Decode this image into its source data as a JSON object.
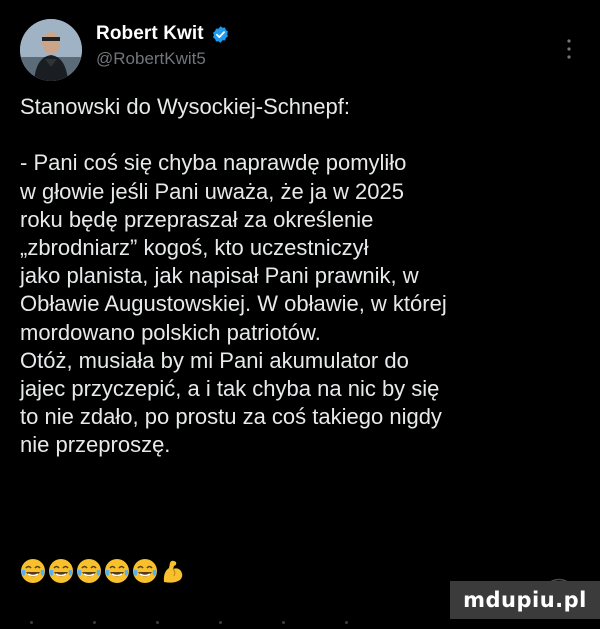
{
  "author": {
    "display_name": "Robert Kwit",
    "handle": "@RobertKwit5",
    "verified": true,
    "verified_color": "#1d9bf0"
  },
  "tweet": {
    "lines": [
      "Stanowski do Wysockiej-Schnepf:",
      "",
      "- Pani coś się chyba naprawdę pomyliło",
      "w głowie jeśli Pani uważa, że ja w 2025",
      "roku będę przepraszał za określenie",
      "„zbrodniarz” kogoś, kto uczestniczył",
      "jako planista, jak napisał Pani prawnik, w",
      "Obławie Augustowskiej. W obławie, w której",
      "mordowano polskich patriotów.",
      "Otóż, musiała by mi Pani akumulator do",
      "jajec przyczepić, a i tak chyba na nic by się",
      "to nie zdało, po prostu za coś takiego nigdy",
      "nie przeproszę."
    ],
    "emojis": [
      "tears-of-joy-icon",
      "tears-of-joy-icon",
      "tears-of-joy-icon",
      "tears-of-joy-icon",
      "tears-of-joy-icon",
      "flexed-biceps-icon"
    ]
  },
  "watermark": {
    "text": "mdupiu.pl"
  },
  "colors": {
    "background": "#000000",
    "text": "#e7e9ea",
    "secondary": "#71767b",
    "emoji_yellow": "#f7c02c"
  }
}
